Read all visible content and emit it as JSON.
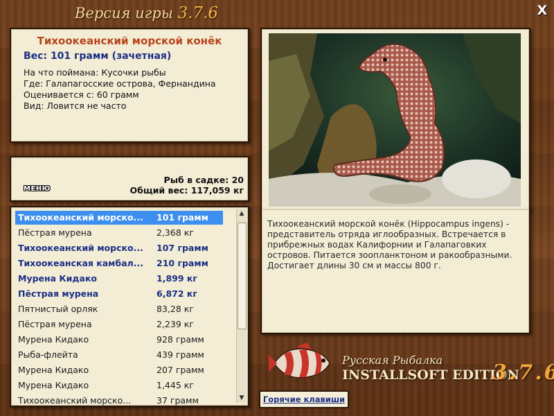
{
  "window": {
    "title_prefix": "Версия игры",
    "title_version": "3.7.6",
    "close_label": "X"
  },
  "fish_info": {
    "name": "Тихоокеанский морской конёк",
    "weight": "Вес: 101 грамм (зачетная)",
    "details": [
      "На что поймана: Кусочки рыбы",
      "Где: Галапагосские острова, Фернандина",
      "Оценивается с: 60 грамм",
      "Вид: Ловится не часто"
    ]
  },
  "cage": {
    "count_line": "Рыб в садке: 20",
    "total_line": "Общий вес: 117,059 кг",
    "menu_label": "МЕНЮ"
  },
  "catch_list": [
    {
      "name": "Тихоокеанский морско...",
      "weight": "101 грамм",
      "style": "sel"
    },
    {
      "name": "Пёстрая мурена",
      "weight": "2,368 кг",
      "style": "norm"
    },
    {
      "name": "Тихоокеанский морско...",
      "weight": "107 грамм",
      "style": "bold"
    },
    {
      "name": "Тихоокеанская камбал...",
      "weight": "210 грамм",
      "style": "bold"
    },
    {
      "name": "Мурена Кидако",
      "weight": "1,899 кг",
      "style": "bold"
    },
    {
      "name": "Пёстрая мурена",
      "weight": "6,872 кг",
      "style": "bold"
    },
    {
      "name": "Пятнистый орляк",
      "weight": "83,28 кг",
      "style": "norm"
    },
    {
      "name": "Пёстрая мурена",
      "weight": "2,239 кг",
      "style": "norm"
    },
    {
      "name": "Мурена Кидако",
      "weight": "928 грамм",
      "style": "norm"
    },
    {
      "name": "Рыба-флейта",
      "weight": "439 грамм",
      "style": "norm"
    },
    {
      "name": "Мурена Кидако",
      "weight": "207 грамм",
      "style": "norm"
    },
    {
      "name": "Мурена Кидако",
      "weight": "1,445 кг",
      "style": "norm"
    },
    {
      "name": "Тихоокеанский морско...",
      "weight": "37 грамм",
      "style": "norm"
    }
  ],
  "description": "Тихоокеанский морской конёк (Hippocampus ingens) - представитель отряда иглообразных. Встречается в прибрежных водах Калифорнии и Галапаговких островов. Питается зоопланктоном и ракообразными. Достигает длины 30 см и массы 800 г.",
  "branding": {
    "line1": "Русская Рыбалка",
    "line2": "INSTALLSOFT EDITION",
    "version": "3.7.6"
  },
  "hotkeys_label": "Горячие клавиши",
  "colors": {
    "accent_title": "#b8441a",
    "weight_blue": "#1b2f86",
    "selection": "#3c8fef",
    "panel_bg": "#f3edd6",
    "wood": "#6b3a18"
  }
}
